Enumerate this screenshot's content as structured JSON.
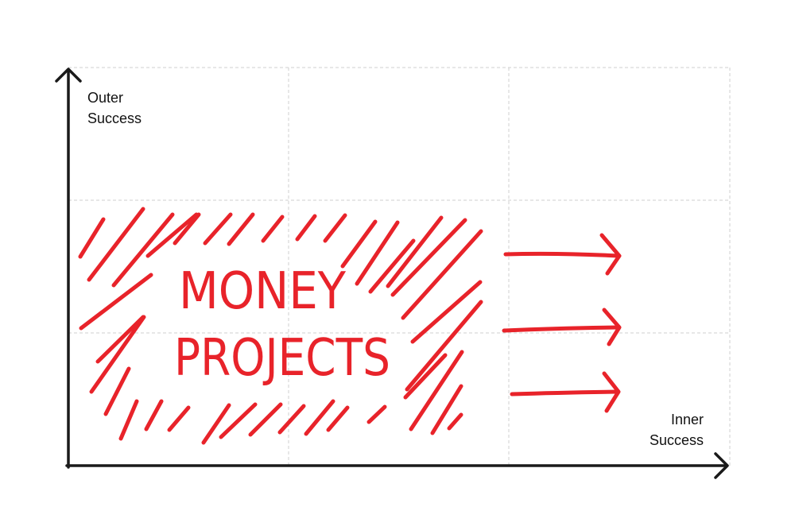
{
  "diagram": {
    "y_axis_label": {
      "line1": "Outer",
      "line2": "Success"
    },
    "x_axis_label": {
      "line1": "Inner",
      "line2": "Success"
    },
    "region_label": {
      "line1": "MONEY",
      "line2": "PROJECTS"
    },
    "arrows": 3
  },
  "colors": {
    "accent": "#e8232a",
    "axis": "#1a1a1a",
    "grid": "#cfcfcf",
    "text": "#111111"
  }
}
